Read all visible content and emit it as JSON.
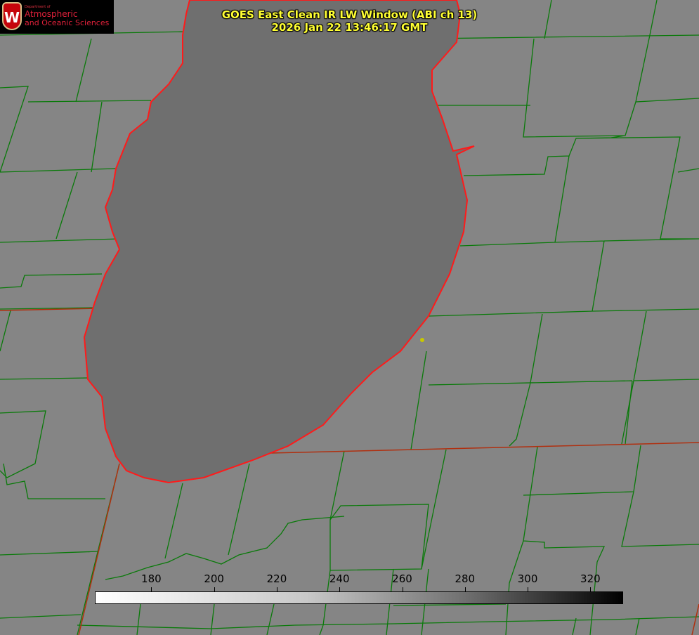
{
  "title": {
    "line1": "GOES East Clean IR LW Window (ABI ch 13)",
    "line2": "2026 Jan 22 13:46:17 GMT"
  },
  "logo": {
    "small": "Department of",
    "line1": "Atmospheric",
    "line2": "and Oceanic Sciences",
    "mark": "W"
  },
  "colorbar": {
    "ticks": [
      "180",
      "200",
      "220",
      "240",
      "260",
      "280",
      "300",
      "320"
    ],
    "range": [
      162,
      330
    ],
    "colors": {
      "low": "#ffffff",
      "high": "#000000"
    }
  },
  "colors": {
    "land": "#858585",
    "lake": "#6e6e6e",
    "county": "#0a7a0a",
    "coast": "#ff1a1a",
    "title": "#ffff33"
  }
}
